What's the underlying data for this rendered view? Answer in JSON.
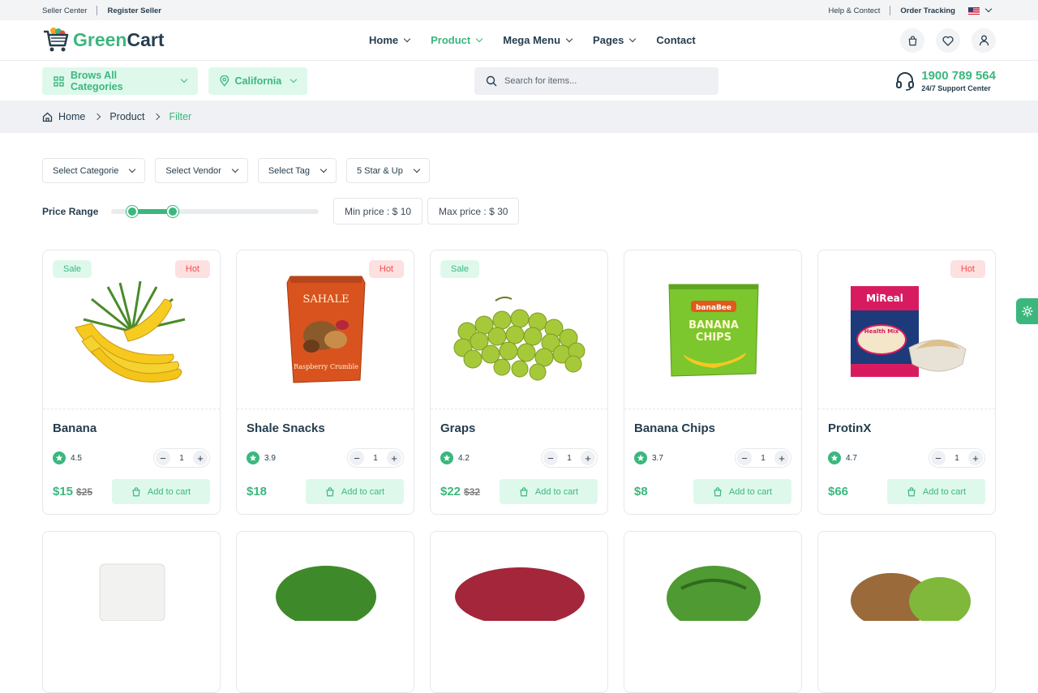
{
  "topbar": {
    "seller_center": "Seller Center",
    "register_seller": "Register Seller",
    "help": "Help & Contect",
    "order_tracking": "Order Tracking"
  },
  "logo": {
    "text_a": "Green",
    "text_b": "Cart"
  },
  "nav": [
    {
      "label": "Home",
      "dropdown": true
    },
    {
      "label": "Product",
      "dropdown": true,
      "active": true
    },
    {
      "label": "Mega Menu",
      "dropdown": true
    },
    {
      "label": "Pages",
      "dropdown": true
    },
    {
      "label": "Contact",
      "dropdown": false
    }
  ],
  "header_icons": [
    "bag-icon",
    "heart-icon",
    "user-icon"
  ],
  "categories_button": "Brows All Categories",
  "location_button": "California",
  "search": {
    "placeholder": "Search for items..."
  },
  "support": {
    "phone": "1900 789 564",
    "label": "24/7 Support Center"
  },
  "breadcrumb": [
    "Home",
    "Product",
    "Filter"
  ],
  "filters": [
    "Select Categorie",
    "Select Vendor",
    "Select Tag",
    "5 Star & Up"
  ],
  "price_range": {
    "label": "Price Range",
    "min_label": "Min price : $ 10",
    "max_label": "Max price : $ 30",
    "min_fraction": 0.1,
    "max_fraction": 0.3
  },
  "products": [
    {
      "name": "Banana",
      "rating": "4.5",
      "qty": "1",
      "price": "$15",
      "old_price": "$25",
      "badges": [
        "Sale",
        "Hot"
      ],
      "cart": "Add to cart"
    },
    {
      "name": "Shale Snacks",
      "rating": "3.9",
      "qty": "1",
      "price": "$18",
      "old_price": "",
      "badges": [
        "Hot"
      ],
      "cart": "Add to cart"
    },
    {
      "name": "Graps",
      "rating": "4.2",
      "qty": "1",
      "price": "$22",
      "old_price": "$32",
      "badges": [
        "Sale"
      ],
      "cart": "Add to cart"
    },
    {
      "name": "Banana Chips",
      "rating": "3.7",
      "qty": "1",
      "price": "$8",
      "old_price": "",
      "badges": [],
      "cart": "Add to cart"
    },
    {
      "name": "ProtinX",
      "rating": "4.7",
      "qty": "1",
      "price": "$66",
      "old_price": "",
      "badges": [
        "Hot"
      ],
      "cart": "Add to cart"
    }
  ],
  "image_text": {
    "sahale": "SAHALE",
    "sahale_sub": "Raspberry Crumble",
    "banabee": "banaBee",
    "banana_chips_1": "BANANA",
    "banana_chips_2": "CHIPS",
    "mireal": "MiReal",
    "health_mix": "Health Mix"
  },
  "colors": {
    "accent": "#3bb77e",
    "accent_light": "#def9ec",
    "hot": "#f74b4b",
    "text": "#253d4e"
  }
}
